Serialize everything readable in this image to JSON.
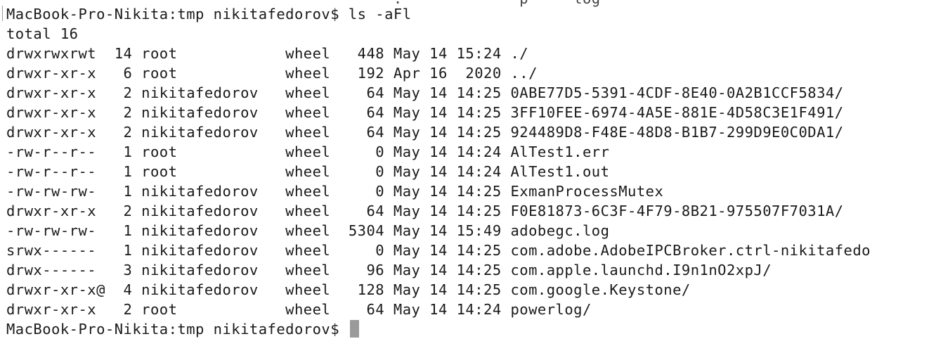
{
  "terminal": {
    "partial_top_line": "                                           .             p     log",
    "prompt": "MacBook-Pro-Nikita:tmp nikitafedorov$ ",
    "command": "ls -aFl",
    "total": "total 16",
    "listing": [
      "drwxrwxrwt  14 root            wheel   448 May 14 15:24 ./",
      "drwxr-xr-x   6 root            wheel   192 Apr 16  2020 ../",
      "drwxr-xr-x   2 nikitafedorov   wheel    64 May 14 14:25 0ABE77D5-5391-4CDF-8E40-0A2B1CCF5834/",
      "drwxr-xr-x   2 nikitafedorov   wheel    64 May 14 14:25 3FF10FEE-6974-4A5E-881E-4D58C3E1F491/",
      "drwxr-xr-x   2 nikitafedorov   wheel    64 May 14 14:25 924489D8-F48E-48D8-B1B7-299D9E0C0DA1/",
      "-rw-r--r--   1 root            wheel     0 May 14 14:24 AlTest1.err",
      "-rw-r--r--   1 root            wheel     0 May 14 14:24 AlTest1.out",
      "-rw-rw-rw-   1 nikitafedorov   wheel     0 May 14 14:25 ExmanProcessMutex",
      "drwxr-xr-x   2 nikitafedorov   wheel    64 May 14 14:25 F0E81873-6C3F-4F79-8B21-975507F7031A/",
      "-rw-rw-rw-   1 nikitafedorov   wheel  5304 May 14 15:49 adobegc.log",
      "srwx------   1 nikitafedorov   wheel     0 May 14 14:25 com.adobe.AdobeIPCBroker.ctrl-nikitafedo",
      "drwx------   3 nikitafedorov   wheel    96 May 14 14:25 com.apple.launchd.I9n1nO2xpJ/",
      "drwxr-xr-x@  4 nikitafedorov   wheel   128 May 14 14:25 com.google.Keystone/",
      "drwxr-xr-x   2 root            wheel    64 May 14 14:24 powerlog/"
    ],
    "final_prompt": "MacBook-Pro-Nikita:tmp nikitafedorov$ "
  }
}
